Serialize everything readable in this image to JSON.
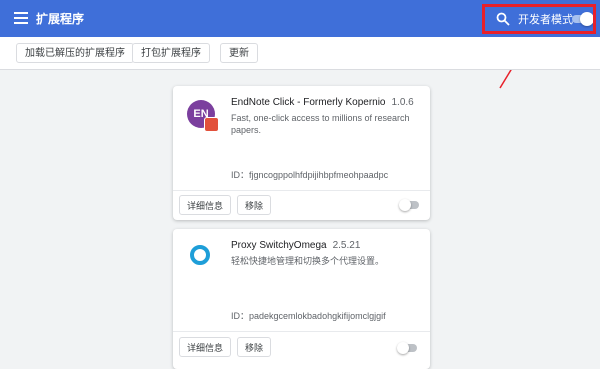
{
  "app": {
    "title": "扩展程序"
  },
  "header": {
    "devmode_label": "开发者模式",
    "devmode_on": true,
    "highlight_color": "#e8202a"
  },
  "toolbar": {
    "load_unpacked": "加载已解压的扩展程序",
    "pack": "打包扩展程序",
    "update": "更新"
  },
  "extensions": [
    {
      "name": "EndNote Click - Formerly Kopernio",
      "version": "1.0.6",
      "description": "Fast, one-click access to millions of research papers.",
      "id_label": "ID：",
      "id": "fjgncogppolhfdpijihbpfmeohpaadpc",
      "details": "详细信息",
      "remove": "移除",
      "icon": "endnote-icon",
      "icon_text": "EN",
      "enabled": false
    },
    {
      "name": "Proxy SwitchyOmega",
      "version": "2.5.21",
      "description": "轻松快捷地管理和切换多个代理设置。",
      "id_label": "ID：",
      "id": "padekgcemlokbadohgkifijomclgjgif",
      "details": "详细信息",
      "remove": "移除",
      "icon": "proxy-switchyomega-icon",
      "enabled": false
    }
  ],
  "colors": {
    "header_bg": "#3f6fd9",
    "page_bg": "#f1f3f4"
  }
}
